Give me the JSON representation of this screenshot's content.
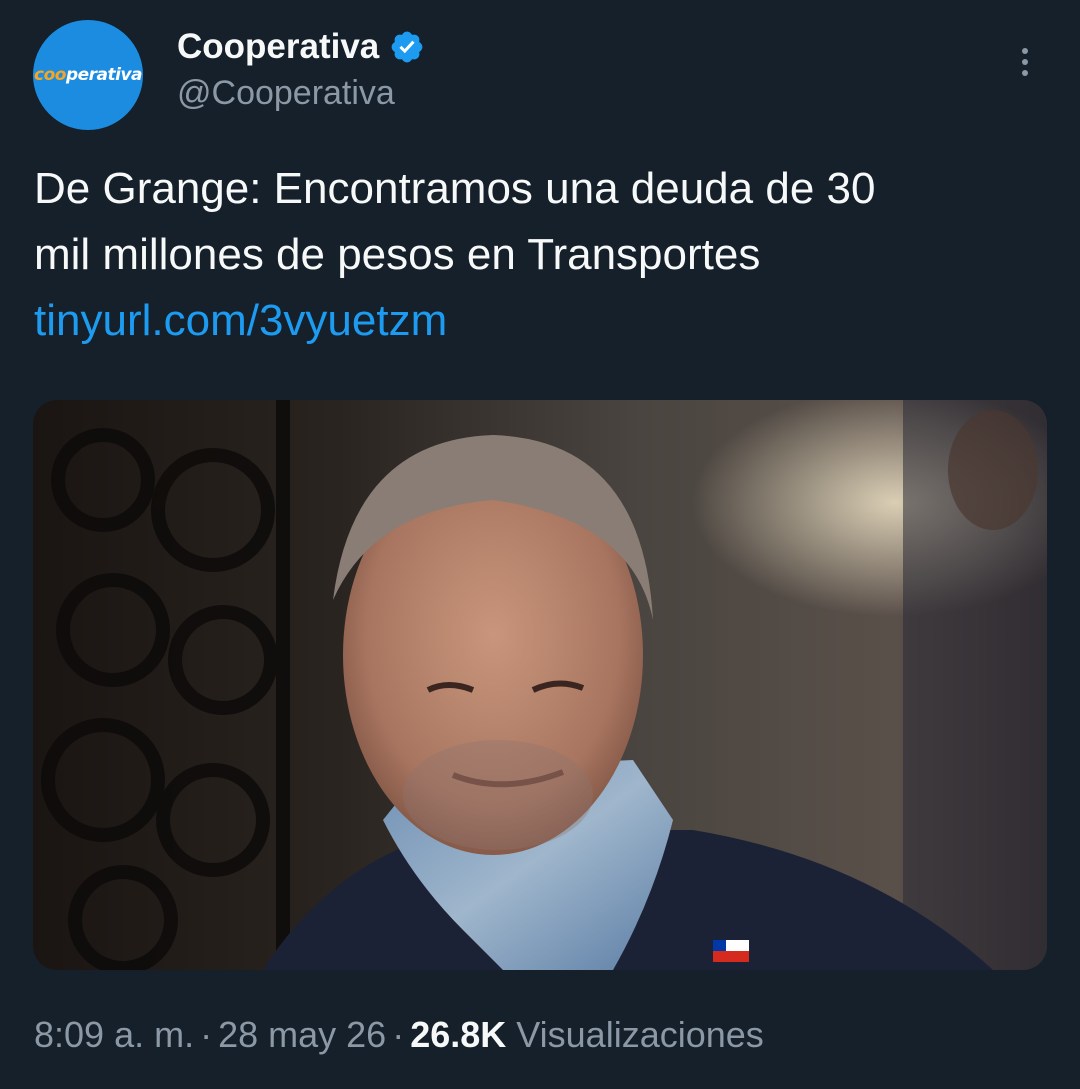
{
  "account": {
    "display_name": "Cooperativa",
    "handle": "@Cooperativa",
    "verified": true,
    "avatar_logo": {
      "accent_part": "coo",
      "rest_part": "perativa"
    },
    "avatar_color": "#1c8ce0"
  },
  "tweet": {
    "text_line_1": "De Grange: Encontramos una deuda de 30",
    "text_line_2": "mil millones de pesos en Transportes",
    "link_text": "tinyurl.com/3vyuetzm",
    "link_color": "#1d9bf0",
    "image_description_icon": "news-photo"
  },
  "meta": {
    "time": "8:09 a. m.",
    "separator": "·",
    "date": "28 may 26",
    "views_count": "26.8K",
    "views_label": "Visualizaciones"
  },
  "icons": {
    "more": "more-vertical-icon",
    "verified": "verified-badge-icon"
  },
  "colors": {
    "background": "#15202b",
    "primary_text": "#f7f9f9",
    "secondary_text": "#8b98a5",
    "verified": "#1d9bf0"
  }
}
